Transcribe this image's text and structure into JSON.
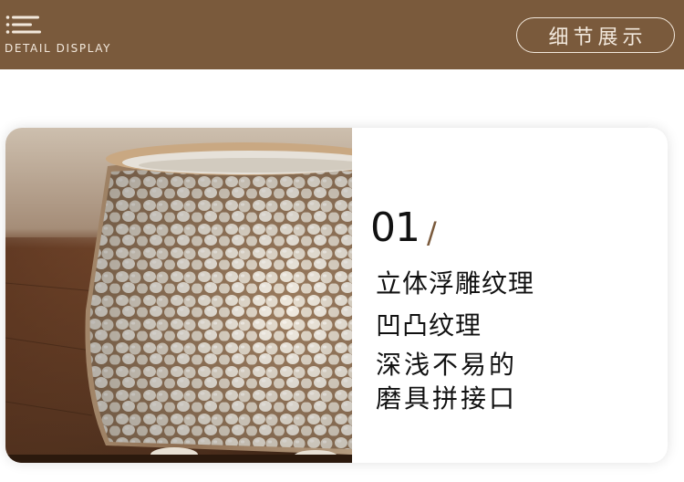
{
  "header": {
    "subtitle": "DETAIL DISPLAY",
    "badge_label": "细节展示",
    "background_color": "#7a5a3c",
    "icon": "menu-icon"
  },
  "detail": {
    "number": "01",
    "separator": "/",
    "lines": [
      "立体浮雕纹理",
      "凹凸纹理",
      "深浅不易的",
      "磨具拼接口"
    ],
    "photo": "cup-texture-photo"
  }
}
